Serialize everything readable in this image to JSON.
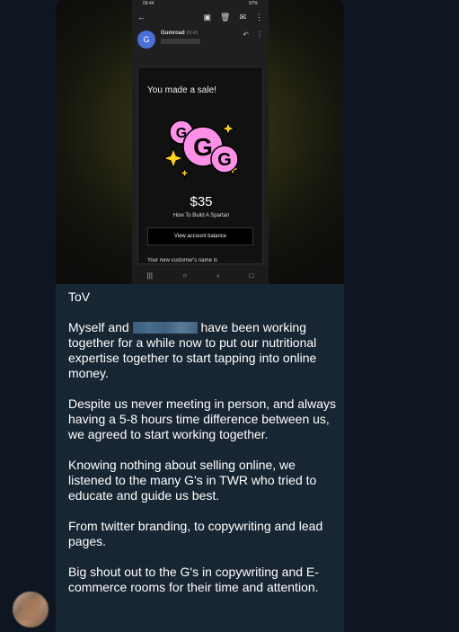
{
  "phone": {
    "status_time": "09:44",
    "status_right": "97%",
    "sender_name": "Gumroad",
    "sender_time": "09:43",
    "sender_initial": "G",
    "sale_title": "You made a sale!",
    "price": "$35",
    "product": "How To Build A Spartan",
    "balance_button": "View account balance",
    "customer_line": "Your new customer's name is"
  },
  "message": {
    "heading": "ToV",
    "p1_before": "Myself and",
    "p1_after": "have been working together for a while now to put our nutritional expertise together to start tapping into online money.",
    "p2": "Despite us never meeting in person, and always having a 5-8 hours time difference between us, we agreed to start working together.",
    "p3": "Knowing nothing about selling online, we listened to the many G's in TWR who tried to educate and guide us best.",
    "p4": "From twitter branding, to copywriting and lead pages.",
    "p5": "Big shout out to the G's in copywriting and E-commerce rooms for their time and attention."
  },
  "icons": [
    "back-arrow-icon",
    "archive-icon",
    "delete-icon",
    "mail-icon",
    "more-icon",
    "reply-icon",
    "gumroad-logo"
  ]
}
